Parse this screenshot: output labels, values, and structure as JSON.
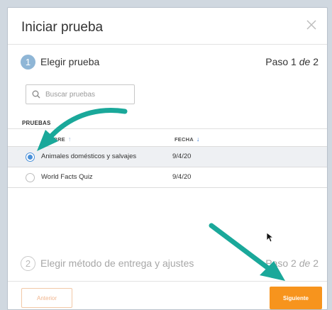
{
  "dialog": {
    "title": "Iniciar prueba",
    "close_icon": "close-icon"
  },
  "step1": {
    "number": "1",
    "label": "Elegir prueba",
    "page_prefix": "Paso 1 ",
    "page_of": "de",
    "page_total": " 2"
  },
  "search": {
    "placeholder": "Buscar pruebas",
    "value": "",
    "icon": "search-icon"
  },
  "tests_label": "PRUEBAS",
  "table": {
    "col_name": "MBRE",
    "col_date": "FECHA",
    "sort_name_icon": "arrow-up-icon",
    "sort_date_icon": "arrow-down-icon",
    "rows": [
      {
        "name": "Animales domésticos y salvajes",
        "date": "9/4/20",
        "selected": true
      },
      {
        "name": "World Facts Quiz",
        "date": "9/4/20",
        "selected": false
      }
    ]
  },
  "step2": {
    "number": "2",
    "label": "Elegir método de entrega y ajustes",
    "page_prefix": "Paso 2 ",
    "page_of": "de",
    "page_total": " 2"
  },
  "footer": {
    "prev_label": "Anterior",
    "next_label": "Siguiente"
  },
  "colors": {
    "accent_orange": "#f7941d",
    "annotation_teal": "#1aa89a",
    "radio_blue": "#4a90d9",
    "step_active": "#8fb6d6"
  }
}
